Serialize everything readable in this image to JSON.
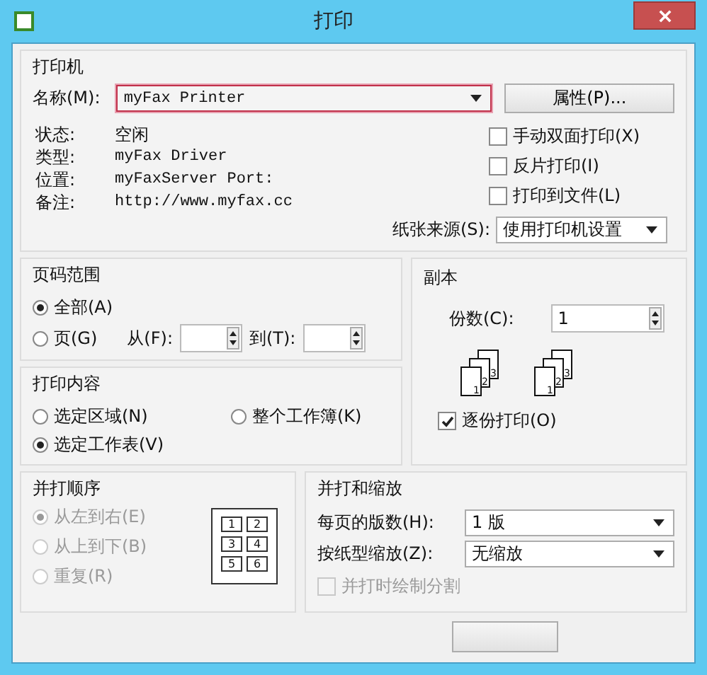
{
  "window": {
    "title": "打印"
  },
  "printer": {
    "title": "打印机",
    "name_label": "名称(M):",
    "name_value": "myFax Printer",
    "properties_button": "属性(P)...",
    "info": [
      {
        "label": "状态:",
        "value": "空闲",
        "kind": "plain"
      },
      {
        "label": "类型:",
        "value": "myFax Driver",
        "kind": "mono"
      },
      {
        "label": "位置:",
        "value": "myFaxServer Port:",
        "kind": "mono"
      },
      {
        "label": "备注:",
        "value": "http://www.myfax.cc",
        "kind": "mono"
      }
    ],
    "options": [
      {
        "label": "手动双面打印(X)",
        "checked": false
      },
      {
        "label": "反片打印(I)",
        "checked": false
      },
      {
        "label": "打印到文件(L)",
        "checked": false
      }
    ],
    "paper_source_label": "纸张来源(S):",
    "paper_source_value": "使用打印机设置"
  },
  "page_range": {
    "title": "页码范围",
    "choices": [
      {
        "label": "全部(A)",
        "selected": true
      },
      {
        "label": "页(G)",
        "selected": false
      }
    ],
    "from_label": "从(F):",
    "to_label": "到(T):"
  },
  "print_content": {
    "title": "打印内容",
    "choices": [
      {
        "label": "选定区域(N)",
        "selected": false
      },
      {
        "label": "整个工作簿(K)",
        "selected": false
      },
      {
        "label": "选定工作表(V)",
        "selected": true
      }
    ]
  },
  "copies": {
    "title": "副本",
    "count_label": "份数(C):",
    "count_value": "1",
    "collate_stack": [
      "1",
      "2",
      "3"
    ],
    "collate_stack_2": [
      "1",
      "2",
      "3"
    ],
    "collate": {
      "label": "逐份打印(O)",
      "checked": true
    }
  },
  "order": {
    "title": "并打顺序",
    "disabled": true,
    "choices": [
      {
        "label": "从左到右(E)",
        "selected": true
      },
      {
        "label": "从上到下(B)",
        "selected": false
      },
      {
        "label": "重复(R)",
        "selected": false
      }
    ],
    "layout_numbers": [
      "1",
      "2",
      "3",
      "4",
      "5",
      "6"
    ]
  },
  "scaling": {
    "title": "并打和缩放",
    "rows": [
      {
        "label": "每页的版数(H):",
        "value": "1 版"
      },
      {
        "label": "按纸型缩放(Z):",
        "value": "无缩放"
      }
    ],
    "draw_borders": {
      "label": "并打时绘制分割",
      "checked": false,
      "disabled": true
    }
  }
}
